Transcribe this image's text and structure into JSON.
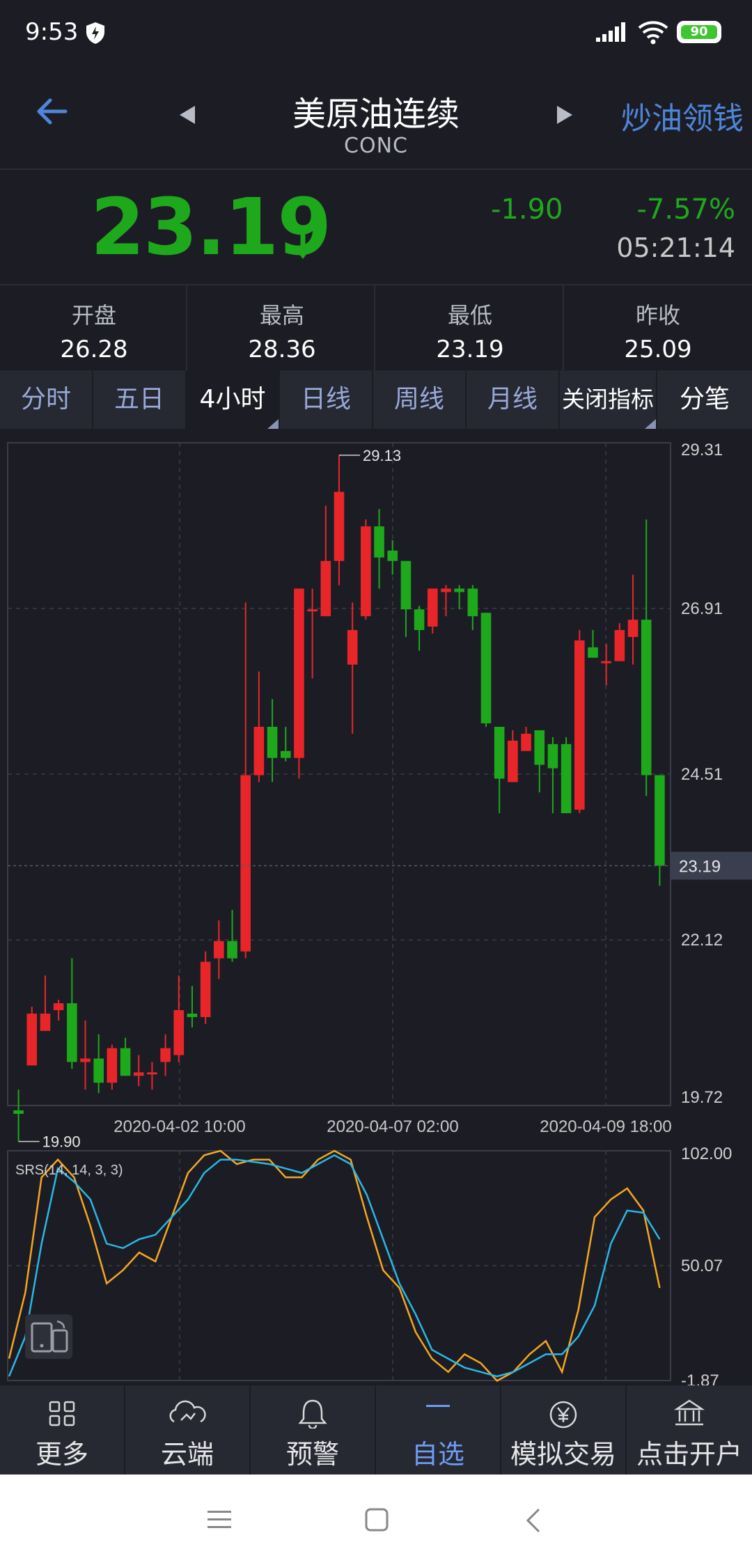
{
  "status_bar": {
    "time": "9:53",
    "battery": "90"
  },
  "header": {
    "title": "美原油连续",
    "code": "CONC",
    "promo": "炒油领钱"
  },
  "quote": {
    "price": "23.19",
    "change": "-1.90",
    "change_pct": "-7.57%",
    "time": "05:21:14",
    "direction": "down",
    "color": "#1ea81c"
  },
  "stats": [
    {
      "label": "开盘",
      "value": "26.28"
    },
    {
      "label": "最高",
      "value": "28.36"
    },
    {
      "label": "最低",
      "value": "23.19"
    },
    {
      "label": "昨收",
      "value": "25.09"
    }
  ],
  "tabs": [
    "分时",
    "五日",
    "4小时",
    "日线",
    "周线",
    "月线",
    "关闭指标",
    "分笔"
  ],
  "active_tab": "4小时",
  "chart_data": [
    {
      "type": "candlestick",
      "y_ticks": [
        "29.31",
        "26.91",
        "24.51",
        "22.12",
        "19.72"
      ],
      "ylim": [
        19.72,
        29.31
      ],
      "x_ticks": [
        "2020-04-02 10:00",
        "2020-04-07 02:00",
        "2020-04-09 18:00"
      ],
      "current_price_label": "23.19",
      "high_annotation": "29.13",
      "low_annotation": "19.90",
      "up_color": "#e8262a",
      "down_color": "#1ea81c",
      "candles": [
        [
          19.65,
          19.95,
          19.2,
          19.6
        ],
        [
          20.3,
          21.15,
          20.3,
          21.05
        ],
        [
          20.8,
          21.6,
          20.8,
          21.05
        ],
        [
          21.1,
          21.25,
          20.95,
          21.2
        ],
        [
          21.2,
          21.85,
          20.25,
          20.35
        ],
        [
          20.35,
          20.95,
          19.95,
          20.4
        ],
        [
          20.4,
          20.75,
          19.9,
          20.05
        ],
        [
          20.05,
          20.6,
          19.95,
          20.55
        ],
        [
          20.55,
          20.7,
          20.15,
          20.15
        ],
        [
          20.15,
          20.45,
          20.0,
          20.2
        ],
        [
          20.2,
          20.35,
          19.95,
          20.2
        ],
        [
          20.35,
          20.75,
          20.15,
          20.55
        ],
        [
          20.45,
          21.6,
          20.35,
          21.1
        ],
        [
          21.05,
          21.45,
          20.85,
          21.0
        ],
        [
          21.0,
          21.95,
          20.9,
          21.8
        ],
        [
          21.85,
          22.4,
          21.55,
          22.1
        ],
        [
          22.1,
          22.55,
          21.8,
          21.85
        ],
        [
          21.95,
          27.0,
          21.85,
          24.5
        ],
        [
          24.5,
          26.0,
          24.4,
          25.2
        ],
        [
          25.2,
          25.6,
          24.4,
          24.75
        ],
        [
          24.85,
          25.2,
          24.7,
          24.75
        ],
        [
          24.75,
          26.95,
          24.45,
          27.2
        ],
        [
          26.9,
          27.2,
          25.9,
          26.9
        ],
        [
          26.8,
          28.4,
          26.8,
          27.6
        ],
        [
          27.6,
          29.13,
          27.25,
          28.6
        ],
        [
          26.1,
          27.0,
          25.1,
          26.6
        ],
        [
          26.8,
          28.2,
          26.75,
          28.1
        ],
        [
          28.1,
          28.35,
          27.2,
          27.65
        ],
        [
          27.75,
          27.9,
          27.4,
          27.6
        ],
        [
          27.6,
          27.5,
          26.5,
          26.9
        ],
        [
          26.9,
          26.95,
          26.3,
          26.6
        ],
        [
          26.65,
          27.2,
          26.55,
          27.2
        ],
        [
          27.15,
          27.25,
          26.8,
          27.2
        ],
        [
          27.2,
          27.25,
          26.9,
          27.15
        ],
        [
          27.2,
          27.25,
          26.6,
          26.8
        ],
        [
          26.85,
          26.85,
          25.2,
          25.25
        ],
        [
          25.2,
          25.2,
          23.95,
          24.45
        ],
        [
          24.4,
          25.15,
          24.4,
          25.0
        ],
        [
          24.85,
          25.2,
          24.85,
          25.1
        ],
        [
          25.15,
          25.15,
          24.25,
          24.65
        ],
        [
          24.95,
          25.05,
          23.95,
          24.6
        ],
        [
          24.95,
          25.05,
          23.95,
          23.95
        ],
        [
          24.0,
          26.6,
          23.95,
          26.45
        ],
        [
          26.35,
          26.6,
          26.2,
          26.2
        ],
        [
          26.15,
          26.4,
          25.8,
          26.15
        ],
        [
          26.15,
          26.7,
          26.15,
          26.6
        ],
        [
          26.5,
          27.4,
          26.1,
          26.75
        ],
        [
          26.75,
          28.2,
          24.2,
          24.5
        ],
        [
          24.5,
          24.5,
          22.9,
          23.19
        ]
      ]
    },
    {
      "type": "line",
      "title": "SRS(14, 14, 3, 3)",
      "y_ticks": [
        "102.00",
        "50.07",
        "-1.87"
      ],
      "ylim": [
        -1.87,
        102.0
      ],
      "series": [
        {
          "color": "#f5a623",
          "values": [
            8,
            38,
            90,
            98,
            90,
            68,
            42,
            48,
            56,
            52,
            72,
            92,
            100,
            102,
            96,
            98,
            98,
            90,
            90,
            98,
            102,
            98,
            72,
            48,
            40,
            20,
            8,
            2,
            10,
            6,
            -2,
            2,
            10,
            16,
            2,
            30,
            72,
            80,
            85,
            75,
            40
          ]
        },
        {
          "color": "#2ab7e6",
          "values": [
            0,
            18,
            60,
            94,
            88,
            80,
            60,
            58,
            62,
            64,
            72,
            80,
            92,
            98,
            98,
            97,
            96,
            94,
            92,
            96,
            100,
            96,
            82,
            62,
            42,
            28,
            12,
            8,
            4,
            2,
            0,
            2,
            6,
            10,
            10,
            18,
            32,
            60,
            75,
            74,
            62
          ]
        }
      ]
    }
  ],
  "bottom_nav": [
    {
      "label": "更多",
      "icon": "grid-icon"
    },
    {
      "label": "云端",
      "icon": "cloud-icon"
    },
    {
      "label": "预警",
      "icon": "bell-icon"
    },
    {
      "label": "自选",
      "icon": "dash-icon",
      "active": true
    },
    {
      "label": "模拟交易",
      "icon": "yen-icon"
    },
    {
      "label": "点击开户",
      "icon": "bank-icon"
    }
  ]
}
